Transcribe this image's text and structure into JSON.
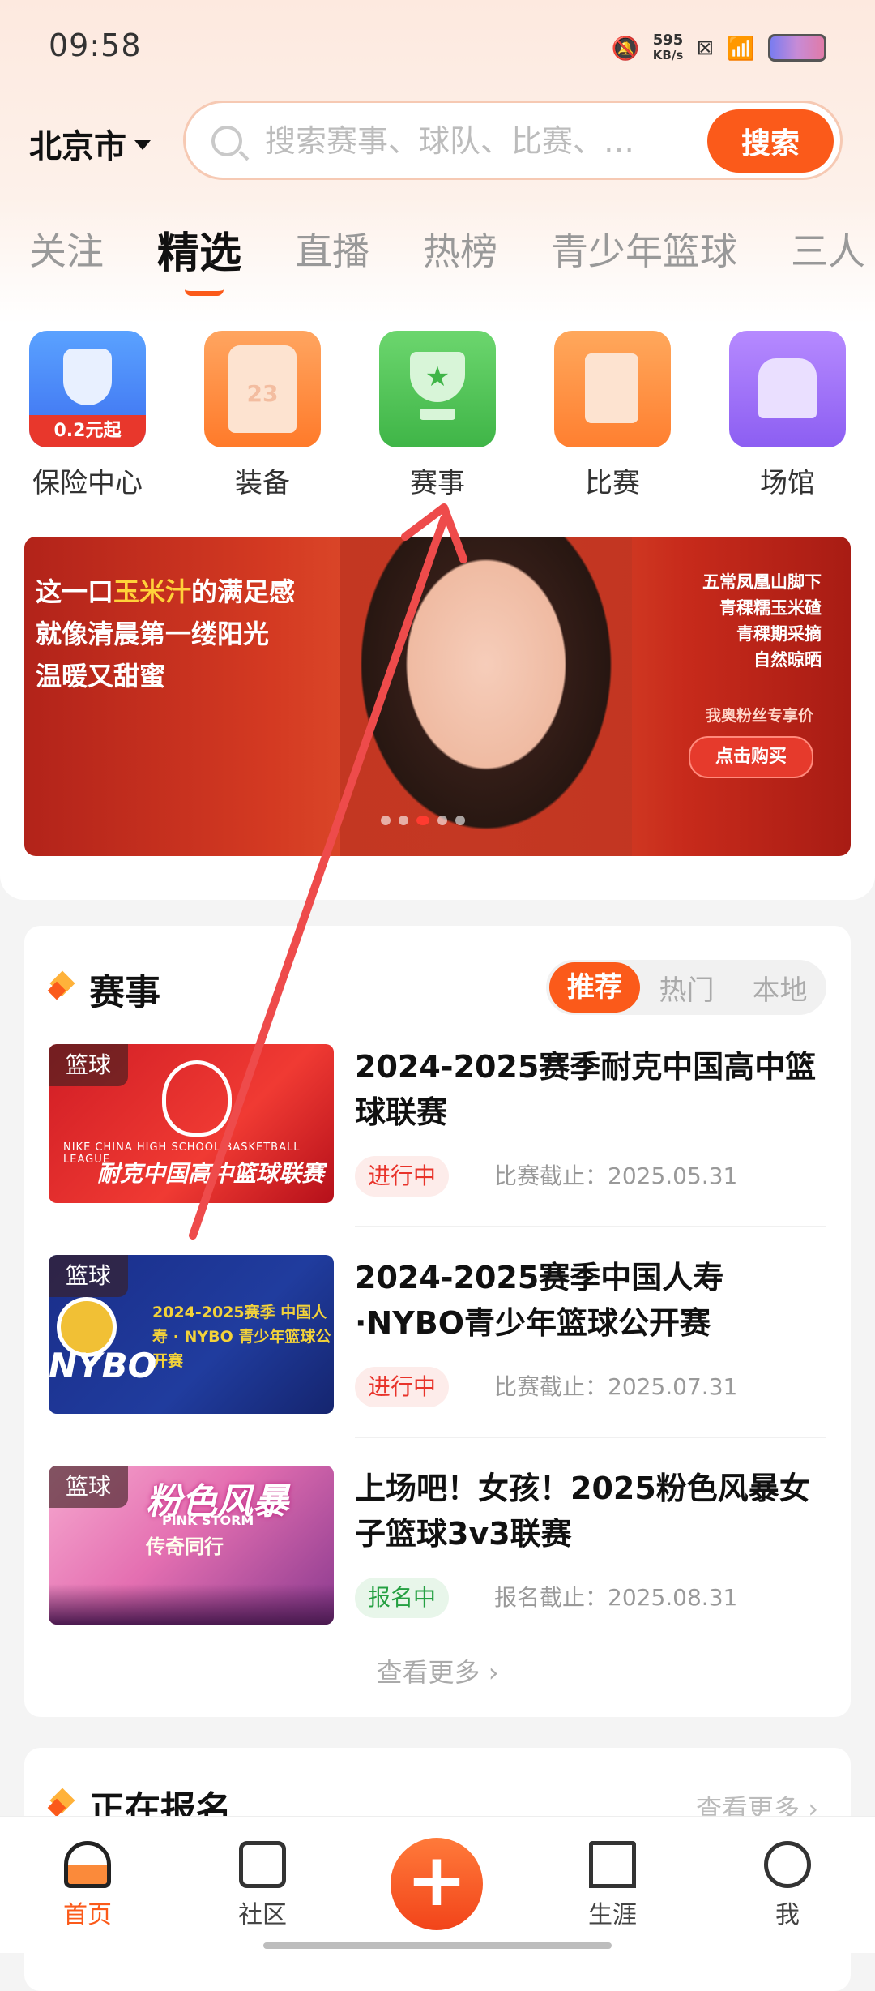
{
  "status_bar": {
    "time": "09:58",
    "net_speed": "595",
    "net_unit": "KB/s"
  },
  "header": {
    "city": "北京市",
    "search_placeholder": "搜索赛事、球队、比赛、…",
    "search_button": "搜索"
  },
  "tabs": [
    "关注",
    "精选",
    "直播",
    "热榜",
    "青少年篮球",
    "三人"
  ],
  "active_tab": "精选",
  "quick_entries": [
    {
      "label": "保险中心",
      "badge": "0.2元起",
      "icon": "shield-icon"
    },
    {
      "label": "装备",
      "icon": "jersey-icon",
      "badge": "23"
    },
    {
      "label": "赛事",
      "icon": "trophy-icon"
    },
    {
      "label": "比赛",
      "icon": "document-icon"
    },
    {
      "label": "场馆",
      "icon": "venue-icon"
    }
  ],
  "banner": {
    "line1_pre": "这一口",
    "line1_hl": "玉米汁",
    "line1_post": "的满足感",
    "line2": "就像清晨第一缕阳光",
    "line3": "温暖又甜蜜",
    "right": [
      "五常凤凰山脚下",
      "青稞糯玉米碴",
      "青稞期采摘",
      "自然晾晒"
    ],
    "fan_price": "我奥粉丝专享价",
    "buy": "点击购买"
  },
  "events_section": {
    "title": "赛事",
    "segments": [
      "推荐",
      "热门",
      "本地"
    ],
    "active_segment": "推荐",
    "items": [
      {
        "tag": "篮球",
        "title": "2024-2025赛季耐克中国高中篮球联赛",
        "status": "进行中",
        "deadline": "比赛截止：2025.05.31",
        "thumb_text": "耐克中国高中篮球联赛",
        "thumb_sub": "NIKE CHINA HIGH SCHOOL BASKETBALL LEAGUE"
      },
      {
        "tag": "篮球",
        "title": "2024-2025赛季中国人寿·NYBO青少年篮球公开赛",
        "status": "进行中",
        "deadline": "比赛截止：2025.07.31",
        "thumb_text": "NYBO",
        "thumb_sub": "2024-2025赛季 中国人寿 · NYBO 青少年篮球公开赛"
      },
      {
        "tag": "篮球",
        "title": "上场吧！女孩！2025粉色风暴女子篮球3v3联赛",
        "status": "报名中",
        "deadline": "报名截止：2025.08.31",
        "thumb_text": "粉色风暴",
        "thumb_sub": "PINK STORM",
        "thumb_sub2": "传奇同行"
      }
    ],
    "more": "查看更多"
  },
  "registering_section": {
    "title": "正在报名",
    "more": "查看更多"
  },
  "tabbar": [
    "首页",
    "社区",
    "生涯",
    "我"
  ],
  "colors": {
    "accent": "#fb5a1a",
    "status_red": "#e8332a",
    "status_green": "#25a042"
  }
}
